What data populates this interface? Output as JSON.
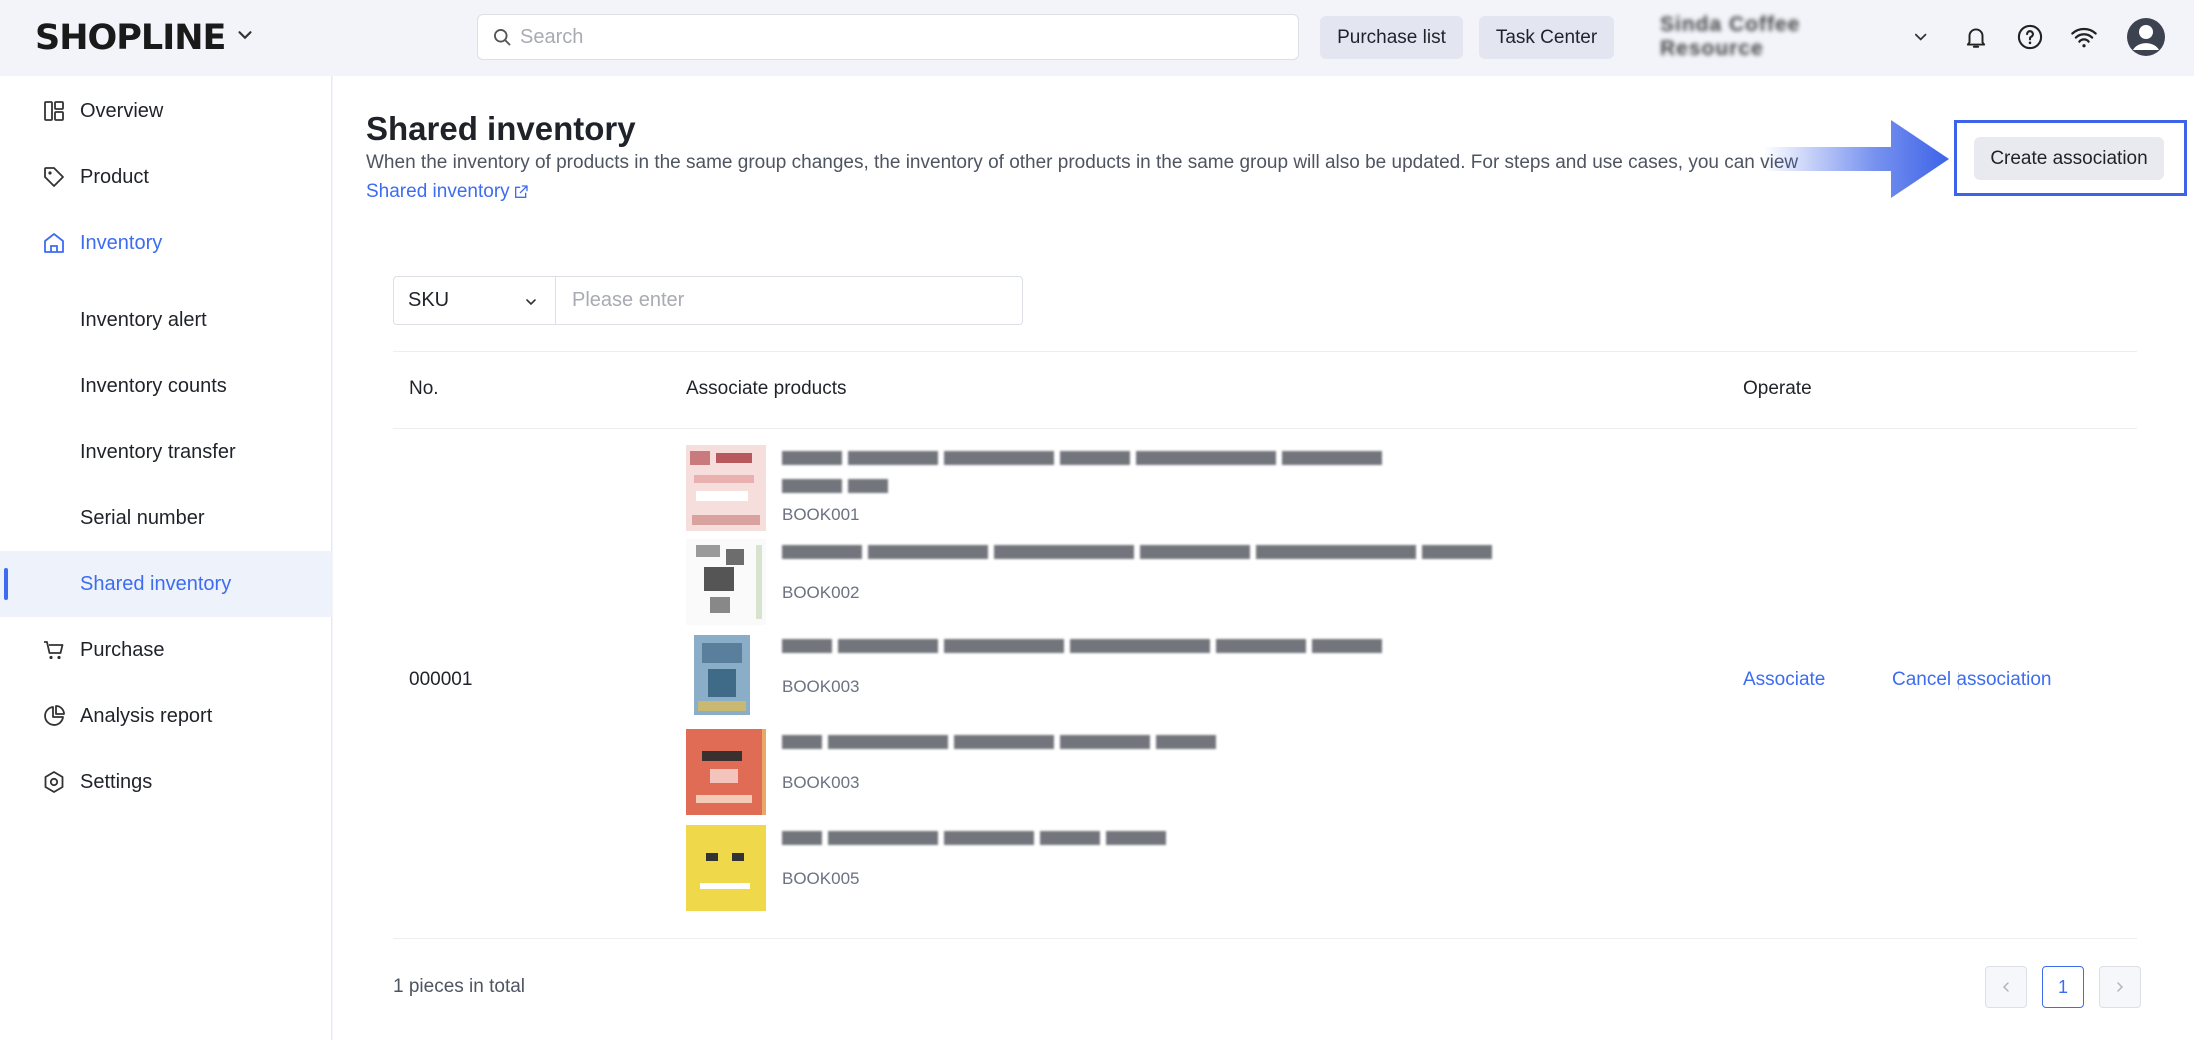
{
  "header": {
    "logo": "SHOPLINE",
    "search_placeholder": "Search",
    "purchase_list": "Purchase list",
    "task_center": "Task Center",
    "store_name": "Sinda Coffee Resource"
  },
  "sidebar": {
    "items": [
      {
        "label": "Overview",
        "icon": "dashboard-icon"
      },
      {
        "label": "Product",
        "icon": "tag-icon"
      },
      {
        "label": "Inventory",
        "icon": "warehouse-icon"
      },
      {
        "label": "Purchase",
        "icon": "cart-icon"
      },
      {
        "label": "Analysis report",
        "icon": "pie-chart-icon"
      },
      {
        "label": "Settings",
        "icon": "hexagon-gear-icon"
      }
    ],
    "inventory_sub": [
      {
        "label": "Inventory alert"
      },
      {
        "label": "Inventory counts"
      },
      {
        "label": "Inventory transfer"
      },
      {
        "label": "Serial number"
      },
      {
        "label": "Shared inventory"
      }
    ]
  },
  "main": {
    "title": "Shared inventory",
    "description": "When the inventory of products in the same group changes, the inventory of other products in the same group will also be updated. For steps and use cases, you can view",
    "help_link": "Shared inventory",
    "create_button": "Create association",
    "filter": {
      "selected": "SKU",
      "placeholder": "Please enter"
    },
    "table": {
      "headers": {
        "no": "No.",
        "products": "Associate products",
        "operate": "Operate"
      },
      "rows": [
        {
          "no": "000001",
          "products": [
            {
              "sku": "BOOK001"
            },
            {
              "sku": "BOOK002"
            },
            {
              "sku": "BOOK003"
            },
            {
              "sku": "BOOK003"
            },
            {
              "sku": "BOOK005"
            }
          ],
          "associate": "Associate",
          "cancel": "Cancel association"
        }
      ]
    },
    "total": "1 pieces in total",
    "pagination": {
      "current": "1"
    }
  },
  "colors": {
    "accent": "#3d6cf0",
    "highlight_frame": "#3d63e8"
  }
}
